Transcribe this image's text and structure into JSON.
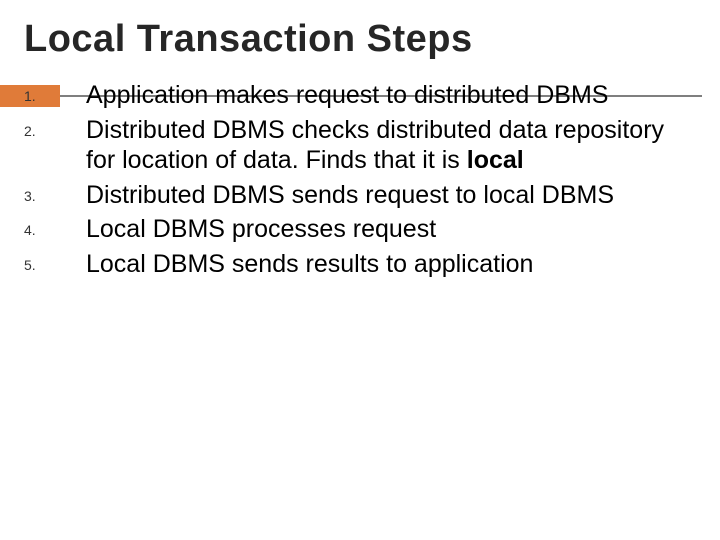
{
  "title": "Local Transaction Steps",
  "items": [
    {
      "num": "1.",
      "text": "Application makes request to distributed DBMS"
    },
    {
      "num": "2.",
      "text_pre": "Distributed DBMS checks distributed data repository for location of data. Finds that it is ",
      "bold": "local"
    },
    {
      "num": "3.",
      "text": "Distributed DBMS sends request to local DBMS"
    },
    {
      "num": "4.",
      "text": "Local DBMS processes request"
    },
    {
      "num": "5.",
      "text": "Local DBMS sends results to application"
    }
  ]
}
